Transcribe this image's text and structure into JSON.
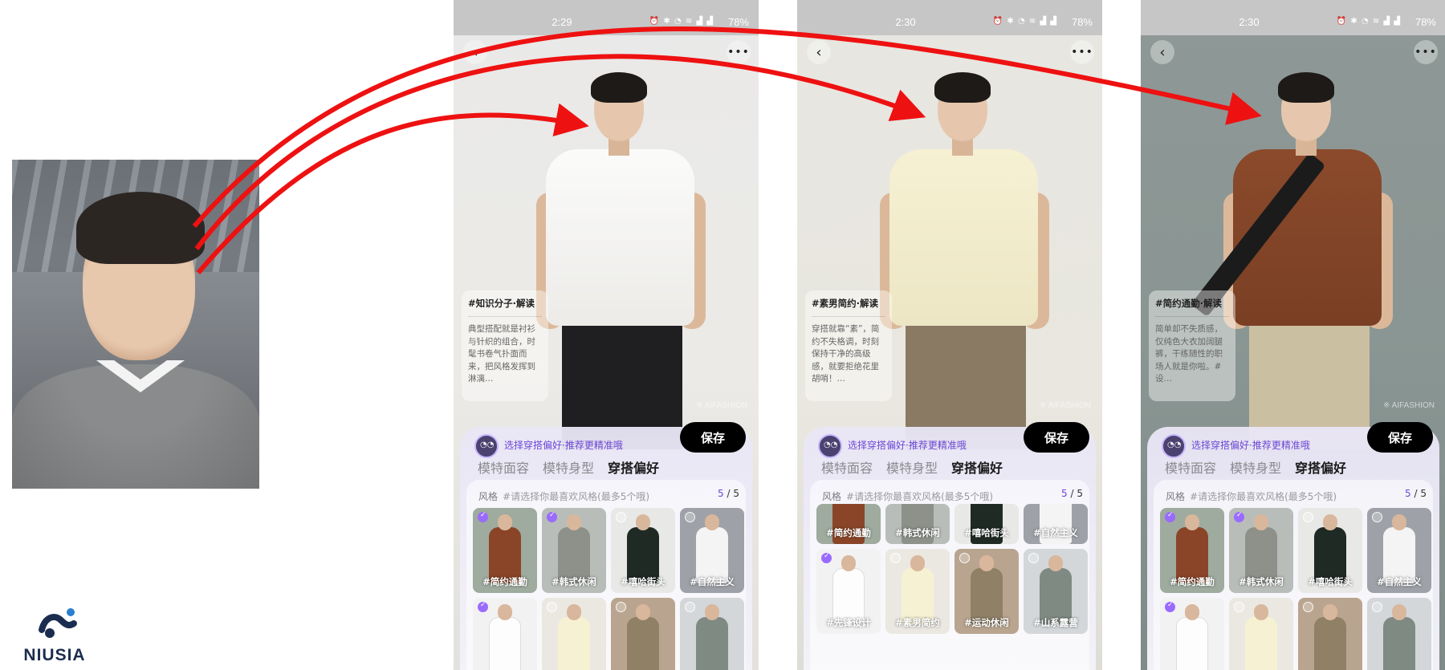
{
  "logo": {
    "text": "NIUSIA"
  },
  "screens": [
    {
      "status": {
        "time": "2:29",
        "battery": "78%"
      },
      "interp_tag": "#知识分子·解读",
      "interp_body": "典型搭配就是衬衫与针织的组合，时髦书卷气扑面而来，把风格发挥到淋漓…",
      "watermark": "※ AIFASHION",
      "hint": "选择穿搭偏好·推荐更精准哦",
      "save": "保存",
      "tabs": [
        "模特面容",
        "模特身型",
        "穿搭偏好"
      ],
      "filter_label": "风格",
      "filter_hint": "#请选择你最喜欢风格(最多5个哦)",
      "count_num": "5",
      "count_total": "/ 5",
      "tiles": [
        "#简约通勤",
        "#韩式休闲",
        "#嘻哈街头",
        "#自然主义",
        "",
        "",
        "",
        ""
      ]
    },
    {
      "status": {
        "time": "2:30",
        "battery": "78%"
      },
      "interp_tag": "#素男简约·解读",
      "interp_body": "穿搭就靠“素”，简约不失格调，时刻保持干净的高级感，就要拒绝花里胡哨！…",
      "watermark": "※ AIFASHION",
      "hint": "选择穿搭偏好·推荐更精准哦",
      "save": "保存",
      "tabs": [
        "模特面容",
        "模特身型",
        "穿搭偏好"
      ],
      "filter_label": "风格",
      "filter_hint": "#请选择你最喜欢风格(最多5个哦)",
      "count_num": "5",
      "count_total": "/ 5",
      "tiles": [
        "#简约通勤",
        "#韩式休闲",
        "#嘻哈街头",
        "#自然主义",
        "#先锋设计",
        "#素男简约",
        "#运动休闲",
        "#山系露营"
      ]
    },
    {
      "status": {
        "time": "2:30",
        "battery": "78%"
      },
      "interp_tag": "#简约通勤·解读",
      "interp_body": "简单却不失质感，仅纯色大衣加阔腿裤，干练随性的职场人就是你啦。#设…",
      "watermark": "※ AIFASHION",
      "hint": "选择穿搭偏好·推荐更精准哦",
      "save": "保存",
      "tabs": [
        "模特面容",
        "模特身型",
        "穿搭偏好"
      ],
      "filter_label": "风格",
      "filter_hint": "#请选择你最喜欢风格(最多5个哦)",
      "count_num": "5",
      "count_total": "/ 5",
      "tiles": [
        "#简约通勤",
        "#韩式休闲",
        "#嘻哈街头",
        "#自然主义",
        "",
        "",
        "",
        ""
      ]
    }
  ],
  "colors": {
    "arrow": "#ee1111",
    "accent": "#6b47d6",
    "save_bg": "#000000"
  },
  "icons": {
    "back": "chevron-left-icon",
    "more": "more-dots-icon"
  }
}
